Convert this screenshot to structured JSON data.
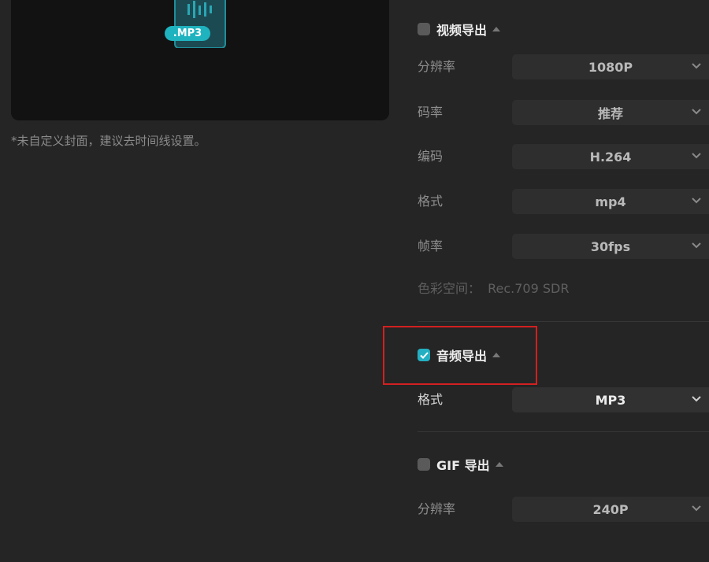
{
  "preview": {
    "badge_text": ".MP3",
    "cover_note": "*未自定义封面，建议去时间线设置。"
  },
  "video_export": {
    "title": "视频导出",
    "checked": false,
    "rows": [
      {
        "label": "分辨率",
        "value": "1080P"
      },
      {
        "label": "码率",
        "value": "推荐"
      },
      {
        "label": "编码",
        "value": "H.264"
      },
      {
        "label": "格式",
        "value": "mp4"
      },
      {
        "label": "帧率",
        "value": "30fps"
      }
    ],
    "color_space_label": "色彩空间：",
    "color_space_value": "Rec.709 SDR"
  },
  "audio_export": {
    "title": "音频导出",
    "checked": true,
    "format_label": "格式",
    "format_value": "MP3"
  },
  "gif_export": {
    "title": "GIF 导出",
    "checked": false,
    "resolution_label": "分辨率",
    "resolution_value": "240P"
  },
  "colors": {
    "accent": "#24b0c2",
    "highlight_box": "#d32020",
    "background": "#252525"
  }
}
